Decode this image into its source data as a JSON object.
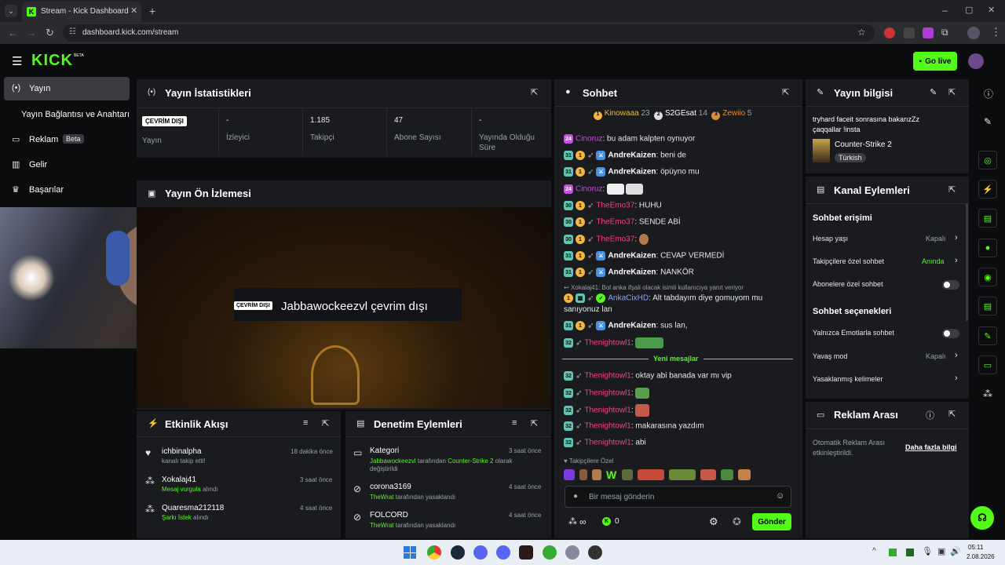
{
  "browser": {
    "tab_title": "Stream - Kick Dashboard",
    "url": "dashboard.kick.com/stream"
  },
  "brand": {
    "logo": "KICK",
    "beta": "BETA",
    "go_live": "Go live"
  },
  "sidebar": {
    "items": [
      {
        "label": "Yayın"
      },
      {
        "label": "Yayın Bağlantısı ve Anahtarı"
      },
      {
        "label": "Reklam",
        "badge": "Beta"
      },
      {
        "label": "Gelir"
      },
      {
        "label": "Başarılar"
      }
    ]
  },
  "stats": {
    "title": "Yayın İstatistikleri",
    "offline_badge": "ÇEVRİM DIŞI",
    "items": [
      {
        "value": "",
        "label": "Yayın"
      },
      {
        "value": "-",
        "label": "İzleyici"
      },
      {
        "value": "1.185",
        "label": "Takipçi"
      },
      {
        "value": "47",
        "label": "Abone Sayısı"
      },
      {
        "value": "-",
        "label": "Yayında Olduğu Süre"
      }
    ]
  },
  "preview": {
    "title": "Yayın Ön İzlemesi",
    "offline_badge": "ÇEVRİM DIŞI",
    "offline_text": "Jabbawockeezvl çevrim dışı"
  },
  "activity": {
    "title": "Etkinlik Akışı",
    "items": [
      {
        "name": "ichbinalpha",
        "detail": "kanalı takip etti!",
        "time": "18 dakika önce"
      },
      {
        "name": "Xokalaj41",
        "detail_highlight": "Mesaj vurgula",
        "detail": "alındı",
        "time": "3 saat önce"
      },
      {
        "name": "Quaresma212118",
        "detail_highlight": "Şarkı İstek",
        "detail": "alındı",
        "time": "4 saat önce"
      }
    ]
  },
  "moderation": {
    "title": "Denetim Eylemleri",
    "items": [
      {
        "name": "Kategori",
        "line1_user": "Jabbawockeezvl",
        "line1_mid": " tarafından ",
        "line1_hl": "Counter-Strike 2",
        "line1_end": " olarak",
        "line2": "değiştirildi",
        "time": "3 saat önce"
      },
      {
        "name": "corona3169",
        "line1_user": "TheWrat",
        "line1_end": " tarafından yasaklandı",
        "time": "4 saat önce"
      },
      {
        "name": "FOLCORD",
        "line1_user": "TheWrat",
        "line1_end": " tarafından yasaklandı",
        "time": "4 saat önce"
      }
    ]
  },
  "chat": {
    "title": "Sohbet",
    "top": [
      {
        "name": "Kinowaaa",
        "count": "23"
      },
      {
        "name": "S2GEsat",
        "count": "14"
      },
      {
        "name": "Zewiio",
        "count": "5"
      }
    ],
    "messages": [
      {
        "user": "Cinoruz",
        "msg": ": bu adam kalpten oynuyor"
      },
      {
        "user": "AndreKaizen",
        "msg": ": beni de"
      },
      {
        "user": "AndreKaizen",
        "msg": ": öpüyno mu"
      },
      {
        "user": "Cinoruz",
        "msg": ":"
      },
      {
        "user": "TheEmo37",
        "msg": ": HUHU"
      },
      {
        "user": "TheEmo37",
        "msg": ": SENDE ABİ"
      },
      {
        "user": "TheEmo37",
        "msg": ":"
      },
      {
        "user": "AndreKaizen",
        "msg": ": CEVAP VERMEDİ"
      },
      {
        "user": "AndreKaizen",
        "msg": ": NANKÖR"
      },
      {
        "reply": "Xokalaj41: Bol anka ifşali olacak isimli kullanıcıya yanıt veriyor"
      },
      {
        "user": "AnkaCixHD",
        "msg": ": Alt tabdayım diye gomuyom mu"
      },
      {
        "msg_cont": "sanıyonuz lan"
      },
      {
        "user": "AndreKaizen",
        "msg": ": sus lan,"
      },
      {
        "user": "Thenightowl1",
        "msg": ":"
      },
      {
        "user": "Thenightowl1",
        "msg": ": oktay abi banada var mı vip"
      },
      {
        "user": "Thenightowl1",
        "msg": ":"
      },
      {
        "user": "Thenightowl1",
        "msg": ":"
      },
      {
        "user": "Thenightowl1",
        "msg": ": makarasına yazdım"
      },
      {
        "user": "Thenightowl1",
        "msg": ": abi"
      }
    ],
    "new_messages": "Yeni mesajlar",
    "followers_only": "Takipçilere Özel",
    "placeholder": "Bir mesaj gönderin",
    "infinity": "∞",
    "points": "0",
    "send": "Gönder"
  },
  "stream_info": {
    "title": "Yayın bilgisi",
    "line1": "tryhard faceit sonrasına bakarızZz",
    "line2": "çaqqallar !insta",
    "game": "Counter-Strike 2",
    "lang": "Türkish"
  },
  "channel_actions": {
    "title": "Kanal Eylemleri",
    "chat_access": "Sohbet erişimi",
    "account_age": "Hesap yaşı",
    "account_age_val": "Kapalı",
    "followers_only": "Takipçilere özel sohbet",
    "followers_only_val": "Anında",
    "subs_only": "Abonelere özel sohbet",
    "chat_options": "Sohbet seçenekleri",
    "emotes_only": "Yalnızca Emotlarla sohbet",
    "slow_mode": "Yavaş mod",
    "slow_mode_val": "Kapalı",
    "banned_words": "Yasaklanmış kelimeler"
  },
  "ad_break": {
    "title": "Reklam Arası",
    "desc": "Otomatik Reklam Arası etkinleştirildi.",
    "more": "Daha fazla bilgi"
  },
  "taskbar": {
    "time": "05:11",
    "date": "2.08.2026"
  },
  "colors": {
    "accent": "#53fc18",
    "panel": "#191b1f",
    "bg": "#0b0c0e"
  }
}
